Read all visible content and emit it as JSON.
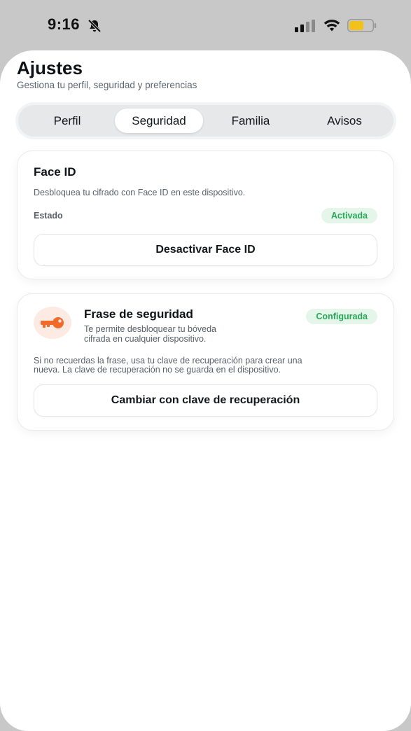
{
  "status_bar": {
    "time": "9:16",
    "icons": [
      "bell-muted-icon",
      "cellular-signal-icon",
      "wifi-icon",
      "battery-icon"
    ],
    "battery_color": "#f2c21b"
  },
  "header": {
    "title": "Ajustes",
    "subtitle": "Gestiona tu perfil, seguridad y preferencias"
  },
  "tabs": [
    {
      "label": "Perfil",
      "active": false
    },
    {
      "label": "Seguridad",
      "active": true
    },
    {
      "label": "Familia",
      "active": false
    },
    {
      "label": "Avisos",
      "active": false
    }
  ],
  "face_id": {
    "title": "Face ID",
    "description": "Desbloquea tu cifrado con Face ID en este dispositivo.",
    "status_label": "Estado",
    "status_value": "Activada",
    "button_label": "Desactivar Face ID"
  },
  "phrase": {
    "icon": "key-icon",
    "title": "Frase de seguridad",
    "badge": "Configurada",
    "description_line1": "Te permite desbloquear tu bóveda",
    "description_line2": "cifrada en cualquier dispositivo.",
    "note_line1": "Si no recuerdas la frase, usa tu clave de recuperación para crear una",
    "note_line2": "nueva. La clave de recuperación no se guarda en el dispositivo.",
    "button_label": "Cambiar con clave de recuperación"
  },
  "colors": {
    "accent_green": "#27a857",
    "badge_bg": "#e4f6ea",
    "key_orange": "#f26a2a",
    "key_bg": "#fdeae2"
  }
}
